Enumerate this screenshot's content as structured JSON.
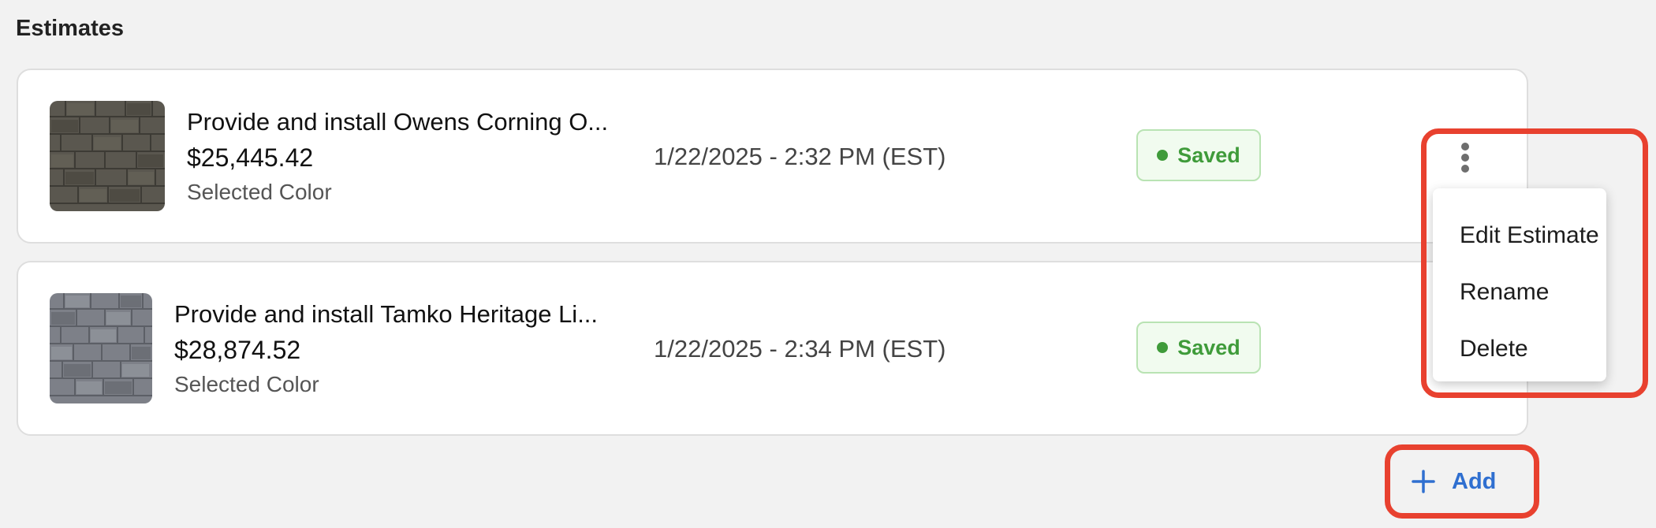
{
  "section": {
    "title": "Estimates"
  },
  "estimates": [
    {
      "title": "Provide and install Owens Corning O...",
      "price": "$25,445.42",
      "color_label": "Selected Color",
      "date": "1/22/2025 - 2:32 PM (EST)",
      "status": "Saved",
      "swatch": "dark-brown-gray-shingle"
    },
    {
      "title": "Provide and install Tamko Heritage Li...",
      "price": "$28,874.52",
      "color_label": "Selected Color",
      "date": "1/22/2025 - 2:34 PM (EST)",
      "status": "Saved",
      "swatch": "slate-gray-shingle"
    }
  ],
  "menu": {
    "items": [
      "Edit Estimate",
      "Rename",
      "Delete"
    ]
  },
  "actions": {
    "add_label": "Add"
  },
  "icons": {
    "more": "kebab-icon",
    "add": "plus-icon",
    "status": "status-dot-icon"
  },
  "colors": {
    "status_green": "#3f9b3a",
    "accent_blue": "#2f6fd0",
    "highlight_red": "#e8412f"
  }
}
